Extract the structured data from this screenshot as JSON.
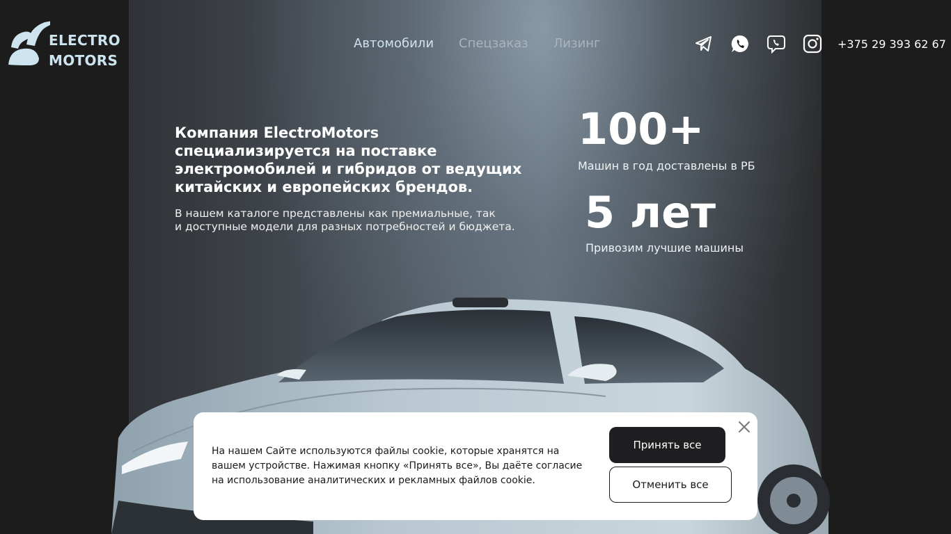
{
  "brand": {
    "line1": "ELECTRO",
    "line2": "MOTORS",
    "logo_icon": "ev-logo-icon",
    "color": "#cde4ef"
  },
  "nav": {
    "items": [
      {
        "label": "Автомобили",
        "active": true
      },
      {
        "label": "Спецзаказ",
        "active": false
      },
      {
        "label": "Лизинг",
        "active": false
      }
    ]
  },
  "socials": [
    "telegram-icon",
    "whatsapp-icon",
    "viber-icon",
    "instagram-icon"
  ],
  "phone": "+375 29 393 62 67",
  "hero": {
    "title": "Компания ElectroMotors специализируется на поставке электромобилей и гибридов от ведущих китайских и европейских брендов.",
    "subtitle_line1": "В нашем каталоге представлены как премиальные, так",
    "subtitle_line2": "и доступные модели для разных потребностей и бюджета."
  },
  "stats": [
    {
      "value": "100+",
      "caption": "Машин в год доставлены в РБ"
    },
    {
      "value": "5 лет",
      "caption": "Привозим лучшие машины"
    }
  ],
  "cookie": {
    "text": "На нашем Сайте используются файлы cookie, которые хранятся на вашем устройстве. Нажимая кнопку «Принять все», Вы даёте согласие на использование аналитических и рекламных файлов cookie.",
    "accept_label": "Принять все",
    "cancel_label": "Отменить все"
  }
}
